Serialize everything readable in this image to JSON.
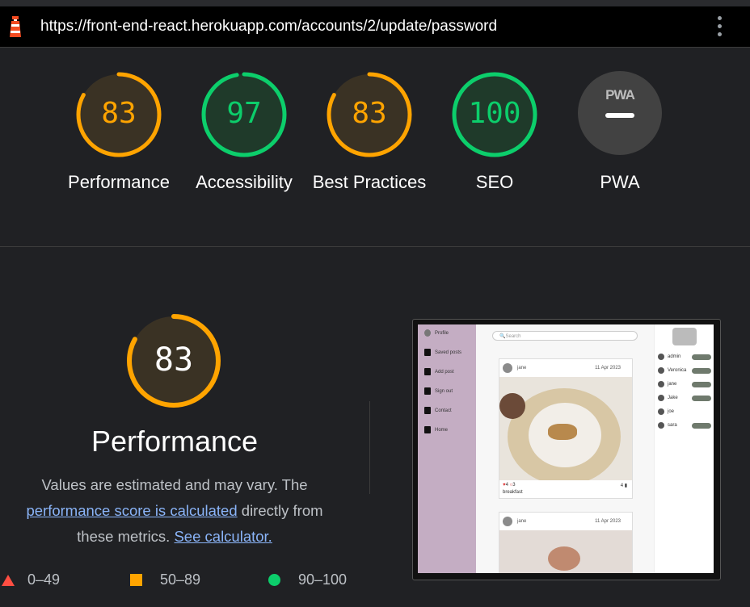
{
  "browser": {
    "url": "https://front-end-react.herokuapp.com/accounts/2/update/password",
    "menu_icon": "kebab-menu-icon"
  },
  "colors": {
    "pass": "#0cce6b",
    "average": "#ffa400",
    "fail": "#ff4e42",
    "pass_text": "#0cce6b",
    "average_text": "#ffa400"
  },
  "scores": [
    {
      "label": "Performance",
      "value": "83",
      "fraction": 0.83,
      "rating": "average"
    },
    {
      "label": "Accessibility",
      "value": "97",
      "fraction": 0.97,
      "rating": "pass"
    },
    {
      "label": "Best Practices",
      "value": "83",
      "fraction": 0.83,
      "rating": "average"
    },
    {
      "label": "SEO",
      "value": "100",
      "fraction": 1.0,
      "rating": "pass"
    }
  ],
  "pwa": {
    "label": "PWA",
    "badge": "PWA"
  },
  "performance": {
    "score": "83",
    "fraction": 0.83,
    "title": "Performance",
    "desc_prefix": "Values are estimated and may vary. The",
    "link1": "performance score is calculated",
    "desc_middle": "directly from these metrics.",
    "link2": "See calculator."
  },
  "legend": [
    {
      "range": "0–49",
      "icon": "triangle-fail-icon"
    },
    {
      "range": "50–89",
      "icon": "square-average-icon"
    },
    {
      "range": "90–100",
      "icon": "circle-pass-icon"
    }
  ],
  "screenshot": {
    "sidebar": [
      "Profile",
      "Saved posts",
      "Add post",
      "Sign out",
      "Contact",
      "Home"
    ],
    "search_placeholder": "Search",
    "post1": {
      "user": "jane",
      "date": "11 Apr 2023",
      "likes": "4",
      "comments": "3",
      "caption": "breakfast",
      "saves": "4"
    },
    "post2": {
      "user": "jane",
      "date": "11 Apr 2023"
    },
    "users": [
      "admin",
      "Veronica",
      "jane",
      "Jake",
      "joe",
      "sara"
    ],
    "follow_label": "unfollow"
  }
}
